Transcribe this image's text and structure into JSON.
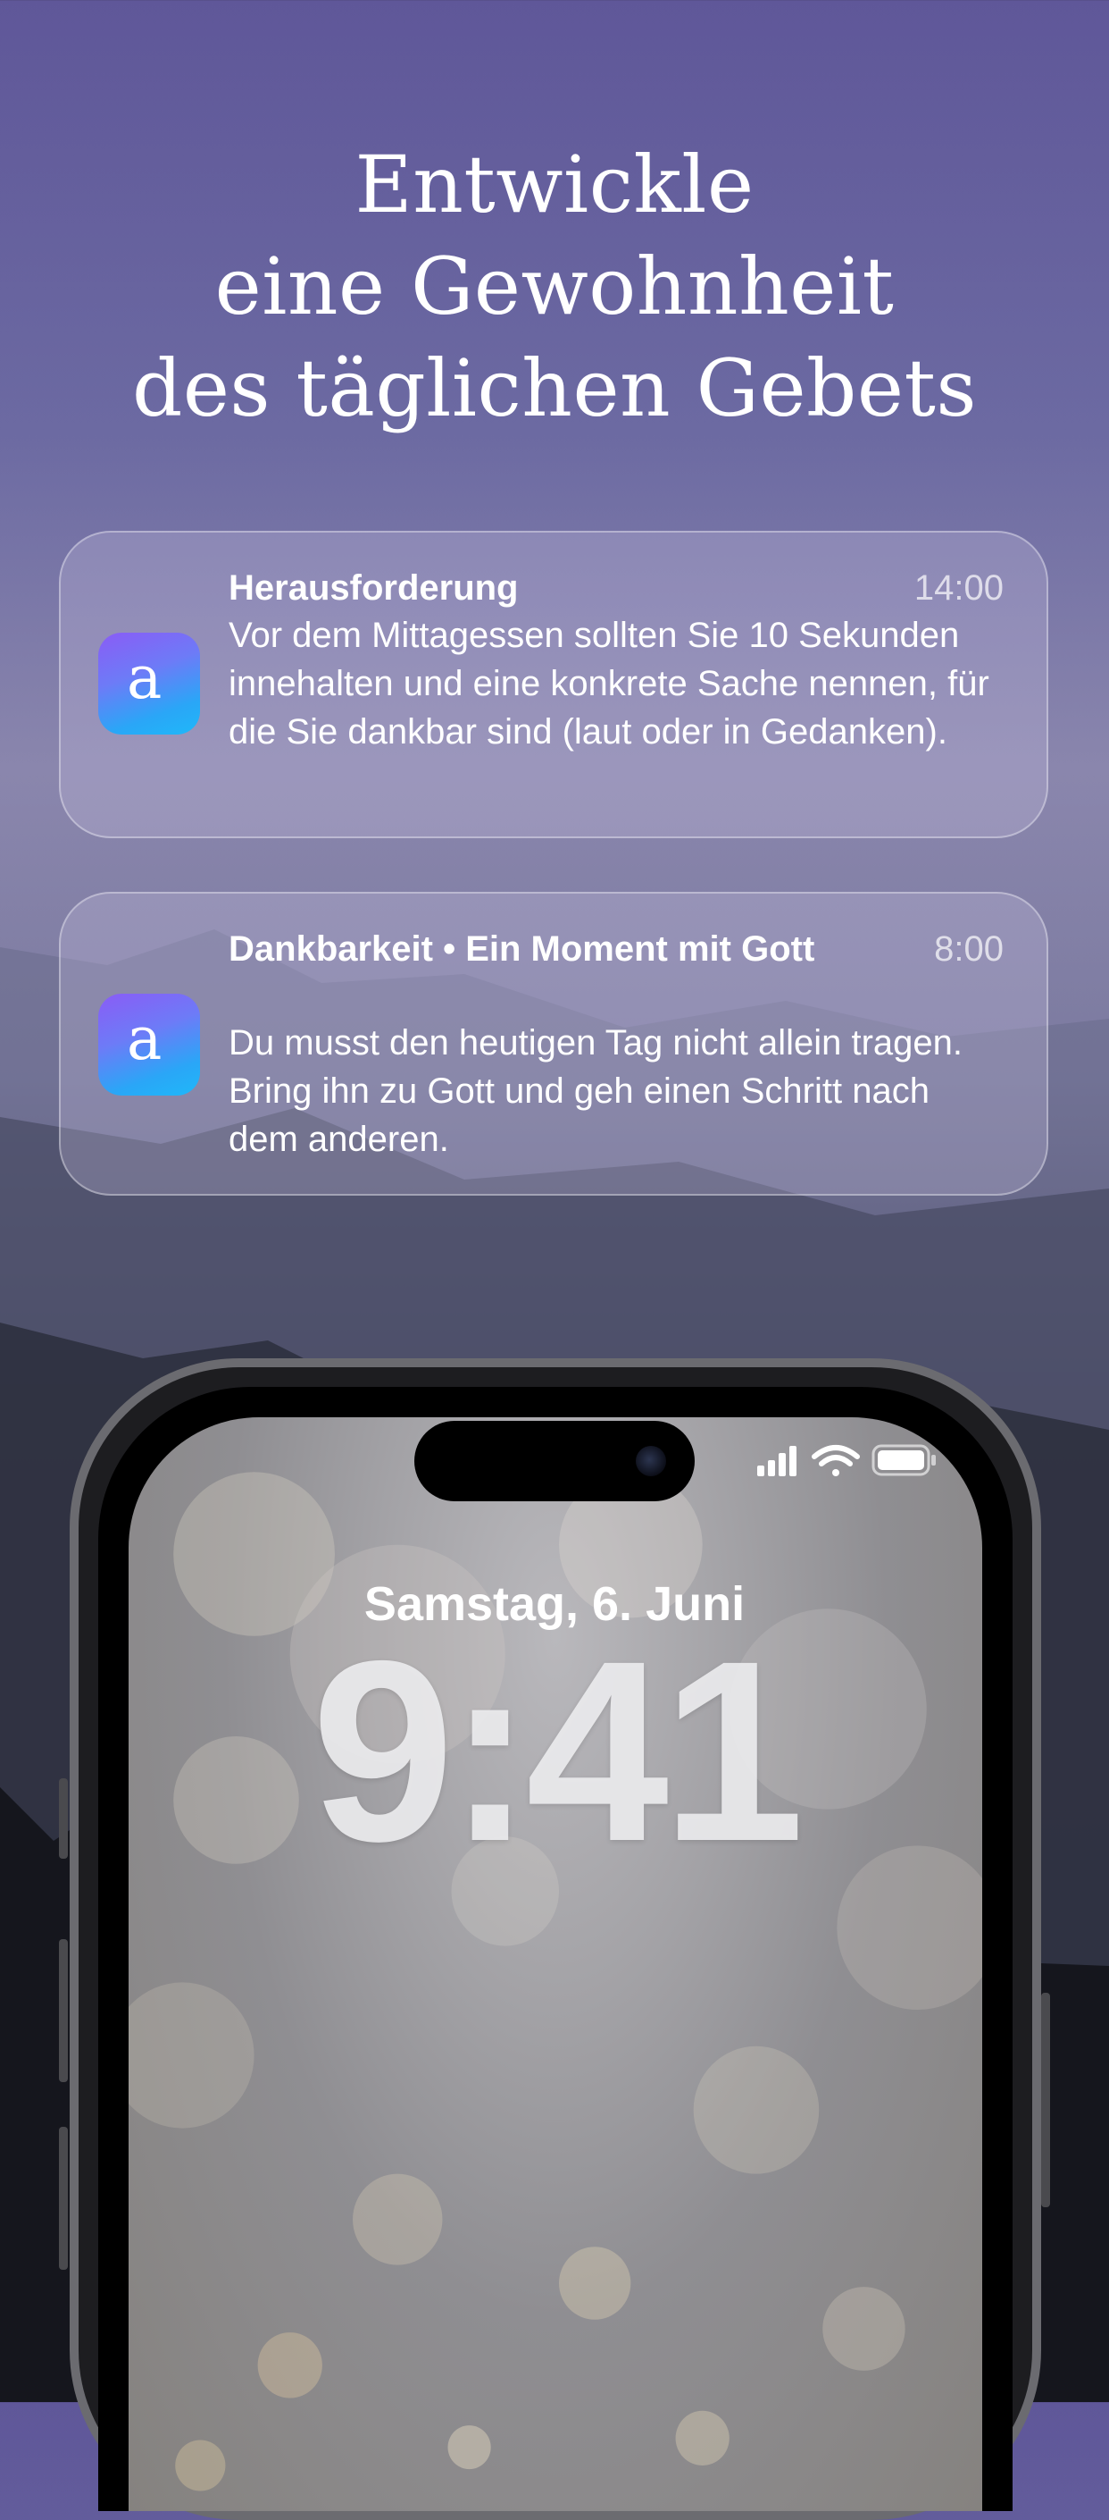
{
  "headline": {
    "line1": "Entwickle",
    "line2": "eine Gewohnheit",
    "line3": "des täglichen Gebets"
  },
  "notifications": [
    {
      "app_icon": "app-a-icon",
      "title": "Herausforderung",
      "time": "14:00",
      "body": "Vor dem Mittagessen sollten Sie 10 Sekunden innehalten und eine konkrete Sache nennen, für die Sie dankbar sind (laut oder in Gedanken)."
    },
    {
      "app_icon": "app-a-icon",
      "title": "Dankbarkeit • Ein Moment mit Gott",
      "time": "8:00",
      "body": "Du musst den heutigen Tag nicht allein tragen. Bring ihn zu Gott und geh einen Schritt nach dem anderen."
    }
  ],
  "app_icon_glyph": "a",
  "lockscreen": {
    "date": "Samstag, 6. Juni",
    "time": "9:41",
    "status_icons": [
      "signal-icon",
      "wifi-icon",
      "battery-icon"
    ]
  },
  "colors": {
    "icon_gradient_top": "#8a5cf6",
    "icon_gradient_bottom": "#1fb8f8"
  }
}
